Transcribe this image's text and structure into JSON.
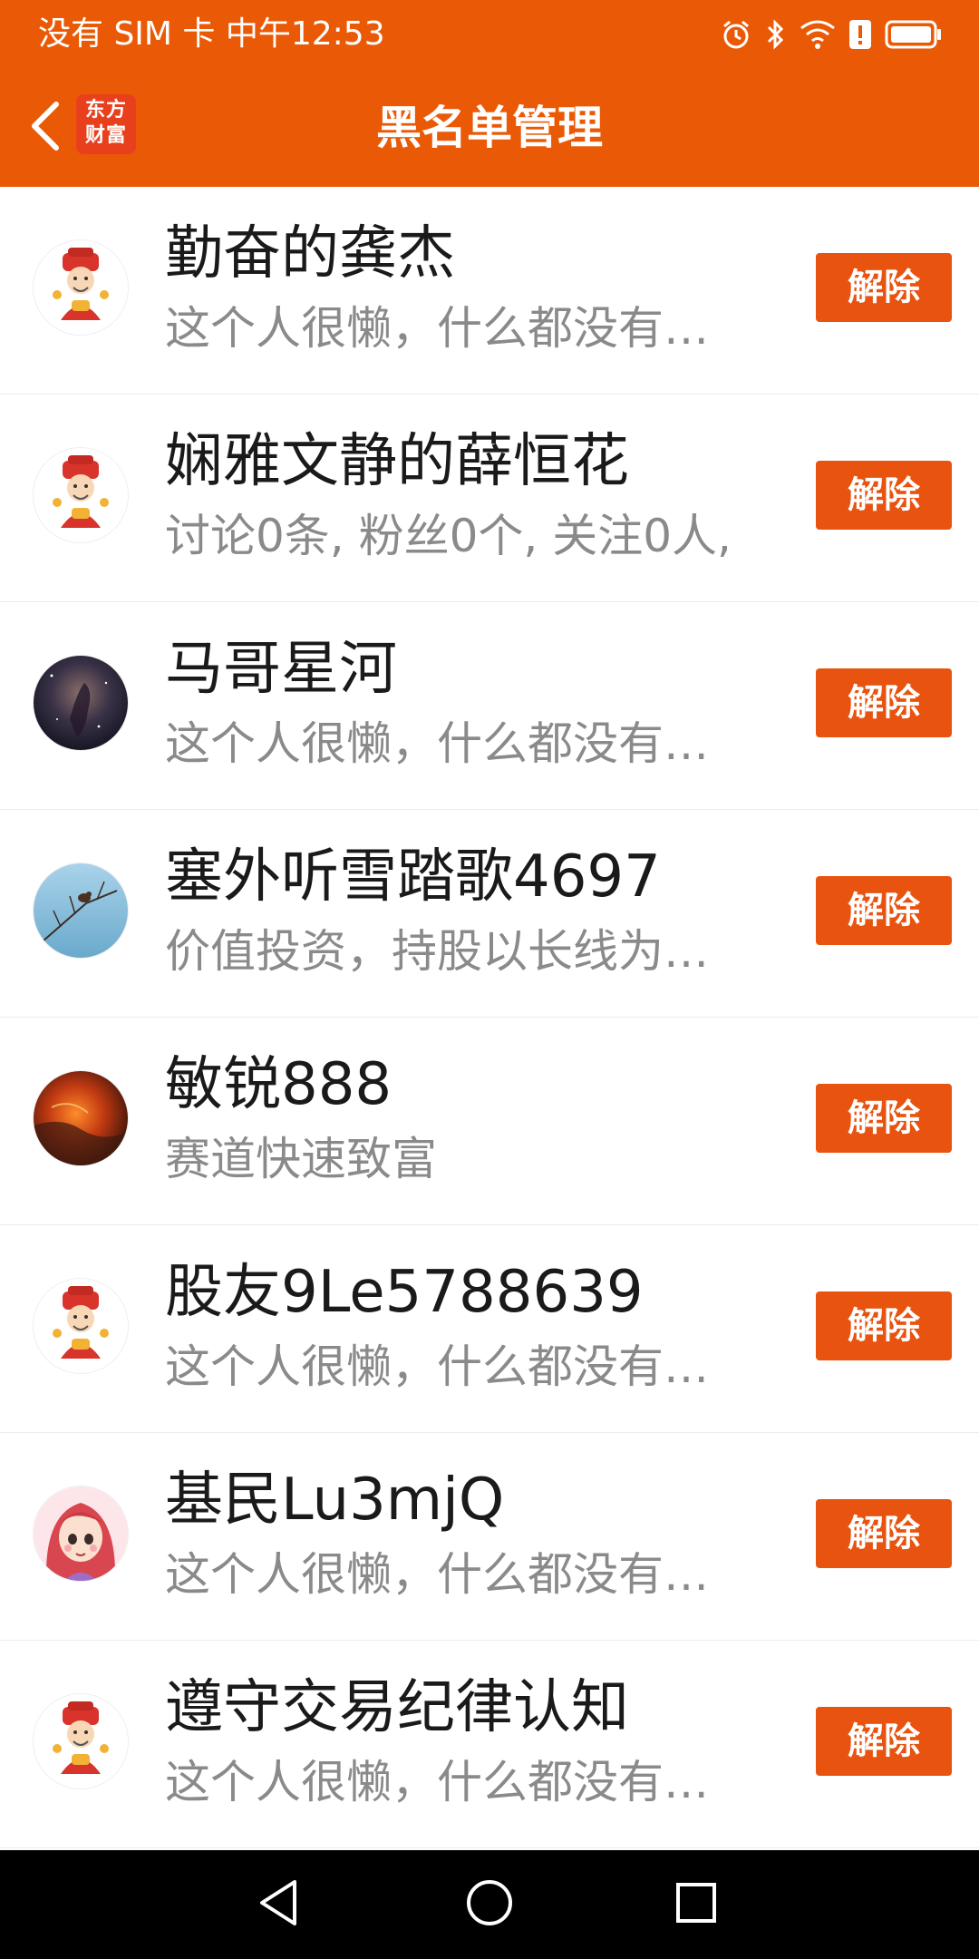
{
  "status_bar": {
    "text": "没有 SIM 卡 中午12:53",
    "icons": [
      "alarm-icon",
      "bluetooth-icon",
      "wifi-icon",
      "battery-alert-icon",
      "battery-icon"
    ]
  },
  "title_bar": {
    "back_icon": "chevron-left-icon",
    "logo_line1": "东方",
    "logo_line2": "财富",
    "title": "黑名单管理"
  },
  "colors": {
    "accent": "#ea5a06",
    "button": "#e8530f",
    "name_text": "#1a1a1a",
    "desc_text": "#8a8a8a"
  },
  "blacklist": [
    {
      "name": "勤奋的龚杰",
      "desc": "这个人很懒，什么都没有…",
      "avatar": "caishen-avatar",
      "button": "解除"
    },
    {
      "name": "娴雅文静的薛恒花",
      "desc": "讨论0条, 粉丝0个, 关注0人,",
      "avatar": "caishen-avatar",
      "button": "解除"
    },
    {
      "name": "马哥星河",
      "desc": "这个人很懒，什么都没有…",
      "avatar": "nebula-avatar",
      "button": "解除"
    },
    {
      "name": "塞外听雪踏歌4697",
      "desc": "价值投资，持股以长线为…",
      "avatar": "bird-branch-avatar",
      "button": "解除"
    },
    {
      "name": "敏锐888",
      "desc": "赛道快速致富",
      "avatar": "lava-avatar",
      "button": "解除"
    },
    {
      "name": "股友9Le5788639",
      "desc": "这个人很懒，什么都没有…",
      "avatar": "caishen-avatar",
      "button": "解除"
    },
    {
      "name": "基民Lu3mjQ",
      "desc": "这个人很懒，什么都没有…",
      "avatar": "cartoon-girl-avatar",
      "button": "解除"
    },
    {
      "name": "遵守交易纪律认知",
      "desc": "这个人很懒，什么都没有…",
      "avatar": "caishen-avatar",
      "button": "解除"
    }
  ],
  "nav_bar": {
    "buttons": [
      "back-triangle-icon",
      "home-circle-icon",
      "recents-square-icon"
    ]
  }
}
